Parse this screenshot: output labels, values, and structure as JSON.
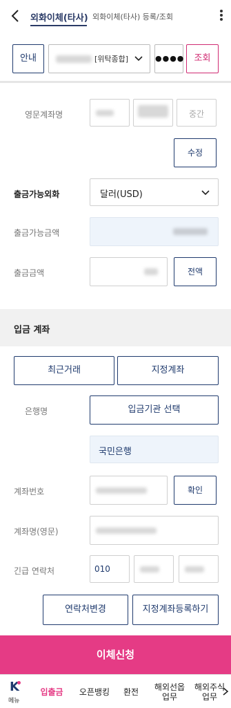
{
  "header": {
    "active_tab": "외화이체(타사)",
    "inactive_tab": "외화이체(타사) 등록/조회"
  },
  "account_row": {
    "guide_label": "안내",
    "account_type_tag": "[위탁종합]",
    "password_mask": "●●●●",
    "inquiry_label": "조회"
  },
  "form": {
    "english_name_label": "영문계좌명",
    "middle_name_placeholder": "중간",
    "edit_button": "수정",
    "currency_label": "출금가능외화",
    "currency_value": "달러(USD)",
    "available_amount_label": "출금가능금액",
    "withdraw_amount_label": "출금금액",
    "all_amount_button": "전액"
  },
  "deposit_section": {
    "title": "입금 계좌",
    "recent_button": "최근거래",
    "designated_button": "지정계좌",
    "bank_label": "은행명",
    "select_bank_button": "입금기관 선택",
    "selected_bank": "국민은행",
    "account_number_label": "계좌번호",
    "confirm_button": "확인",
    "account_name_label": "계좌명(영문)",
    "emergency_contact_label": "긴급 연락처",
    "phone_prefix": "010",
    "change_contact_button": "연락처변경",
    "register_designated_button": "지정계좌등록하기"
  },
  "submit_button": "이체신청",
  "bottom_nav": {
    "menu_label": "메뉴",
    "items": [
      "입출금",
      "오픈뱅킹",
      "환전",
      "해외선옵\n업무",
      "해외주식\n업무"
    ]
  },
  "colors": {
    "primary_navy": "#1f3a6d",
    "accent_pink": "#e53b85"
  }
}
